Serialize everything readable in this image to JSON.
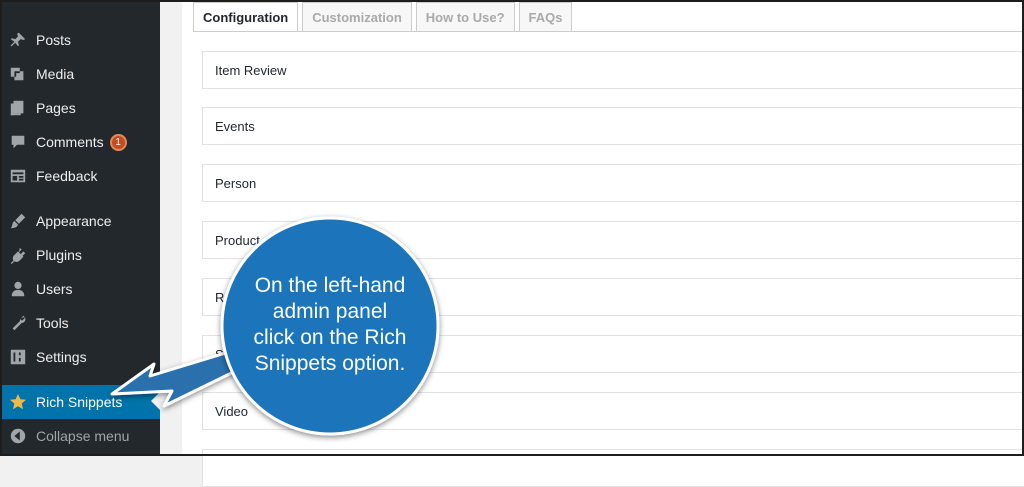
{
  "sidebar": {
    "items": [
      {
        "label": "Posts",
        "icon": "pin-icon"
      },
      {
        "label": "Media",
        "icon": "media-icon"
      },
      {
        "label": "Pages",
        "icon": "pages-icon"
      },
      {
        "label": "Comments",
        "icon": "comment-icon",
        "badge": "1"
      },
      {
        "label": "Feedback",
        "icon": "feedback-icon"
      },
      {
        "label": "Appearance",
        "icon": "brush-icon"
      },
      {
        "label": "Plugins",
        "icon": "plugin-icon"
      },
      {
        "label": "Users",
        "icon": "users-icon"
      },
      {
        "label": "Tools",
        "icon": "wrench-icon"
      },
      {
        "label": "Settings",
        "icon": "settings-icon"
      },
      {
        "label": "Rich Snippets",
        "icon": "star-icon"
      },
      {
        "label": "Collapse menu",
        "icon": "collapse-icon"
      }
    ]
  },
  "tabs": [
    "Configuration",
    "Customization",
    "How to Use?",
    "FAQs"
  ],
  "panels": [
    "Item Review",
    "Events",
    "Person",
    "Product",
    "Re",
    "S",
    "Video"
  ],
  "callout": {
    "text": "On the left-hand\nadmin panel\nclick on the Rich\nSnippets option."
  },
  "colors": {
    "sidebar": "#23282d",
    "active": "#0073aa",
    "callout": "#1b75ba",
    "arrow": "#2a6fad"
  }
}
